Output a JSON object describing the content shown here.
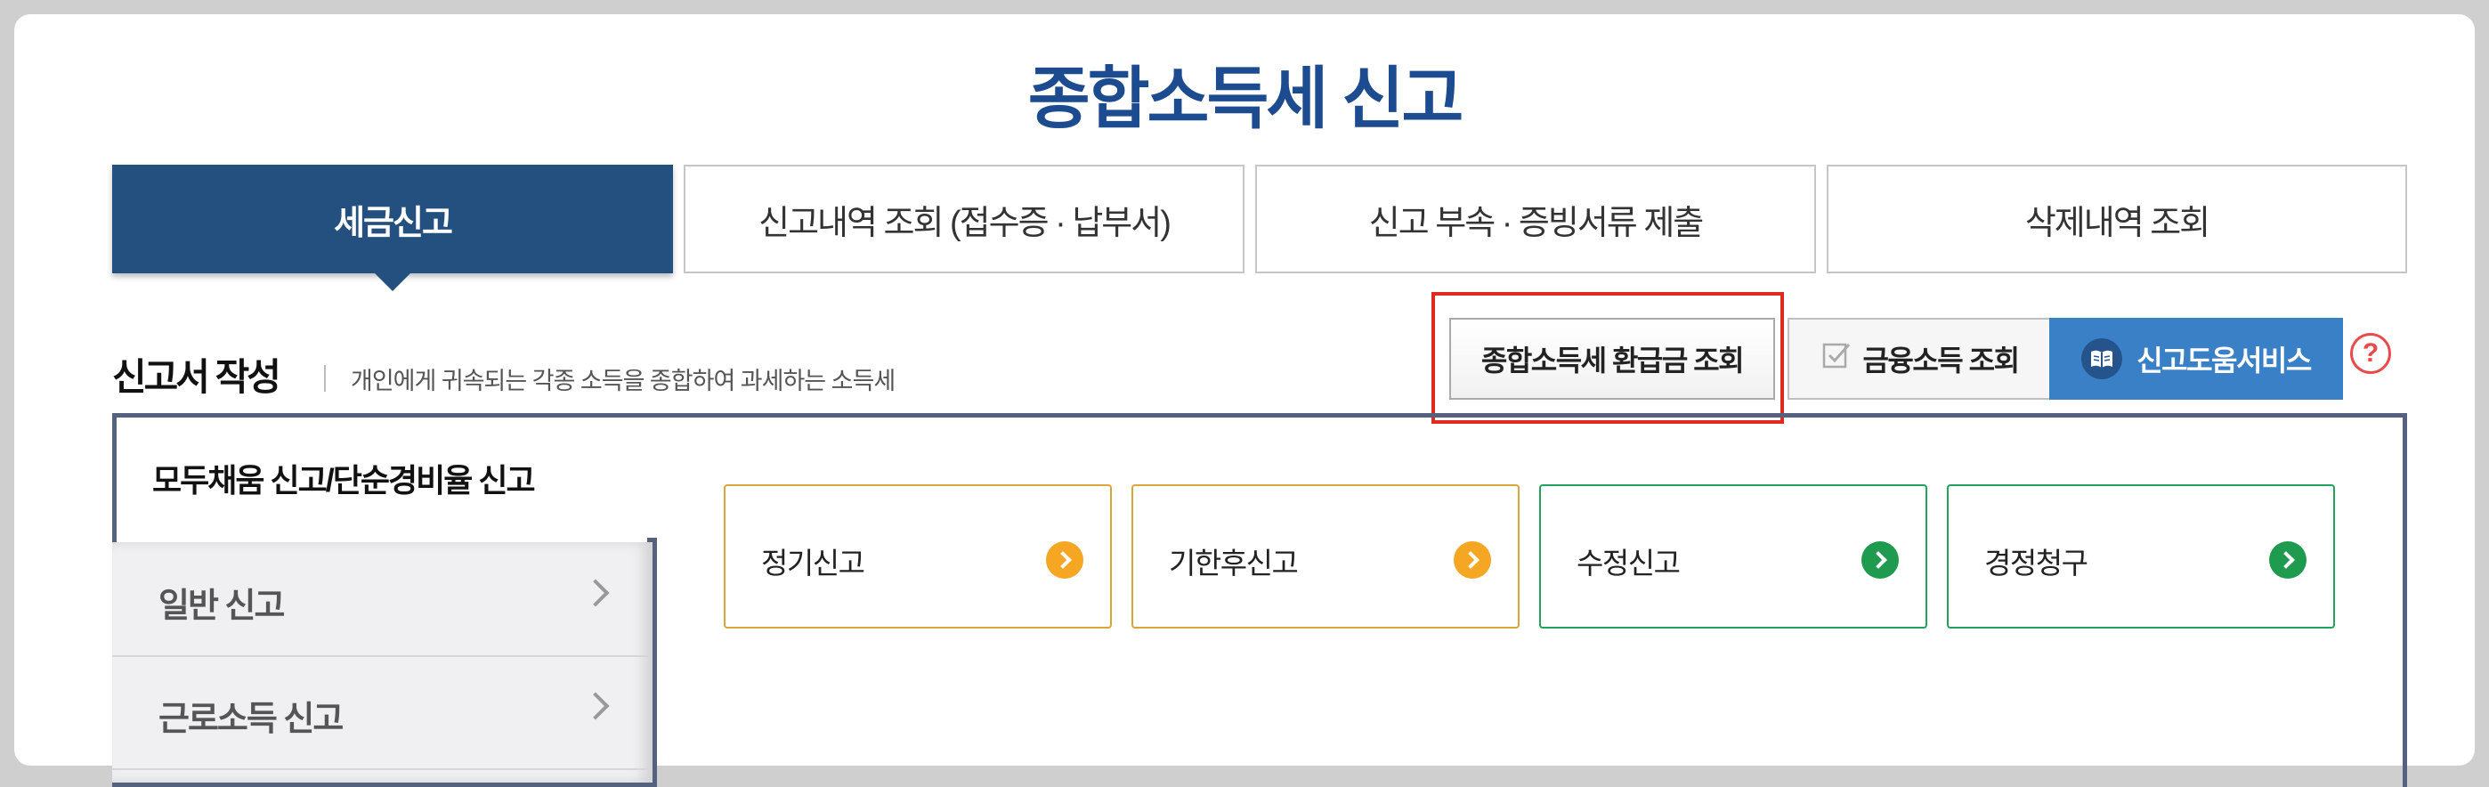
{
  "page": {
    "title": "종합소득세 신고"
  },
  "tabs": [
    {
      "label": "세금신고",
      "active": true
    },
    {
      "label": "신고내역 조회 (접수증 · 납부서)",
      "active": false
    },
    {
      "label": "신고 부속 · 증빙서류 제출",
      "active": false
    },
    {
      "label": "삭제내역 조회",
      "active": false
    }
  ],
  "section": {
    "title": "신고서 작성",
    "description": "개인에게 귀속되는 각종 소득을 종합하여 과세하는 소득세"
  },
  "actions": {
    "refund_lookup": "종합소득세 환급금 조회",
    "finance_income_lookup": "금융소득 조회",
    "filing_help_service": "신고도움서비스",
    "help_mark": "?"
  },
  "sidebar": {
    "header": "모두채움 신고/단순경비율 신고",
    "items": [
      {
        "label": "일반 신고"
      },
      {
        "label": "근로소득 신고"
      }
    ]
  },
  "filing_types": [
    {
      "label": "정기신고",
      "color": "orange"
    },
    {
      "label": "기한후신고",
      "color": "orange"
    },
    {
      "label": "수정신고",
      "color": "green"
    },
    {
      "label": "경정청구",
      "color": "green"
    }
  ],
  "colors": {
    "primary_navy": "#24507f",
    "title_blue": "#1d4b8f",
    "help_blue": "#3a80c7",
    "highlight_red": "#e02a1d",
    "orange": "#f5a623",
    "green": "#1e9b4e"
  }
}
